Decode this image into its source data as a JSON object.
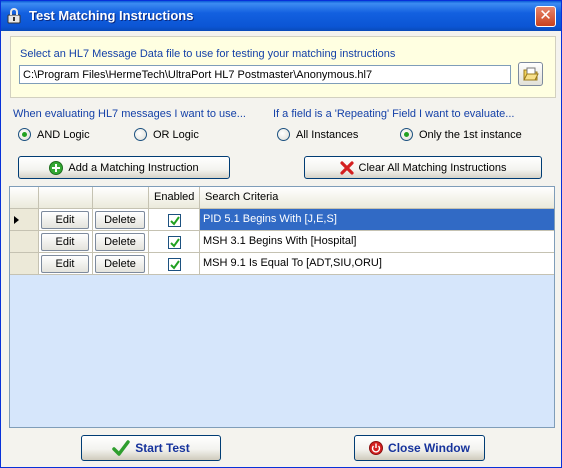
{
  "window": {
    "title": "Test Matching Instructions",
    "close_glyph": "✕"
  },
  "file_section": {
    "prompt": "Select an HL7 Message Data file to use for testing your matching instructions",
    "file_path": "C:\\Program Files\\HermeTech\\UltraPort HL7 Postmaster\\Anonymous.hl7",
    "browse_icon": "open-folder-icon"
  },
  "logic_section": {
    "label": "When evaluating HL7 messages I want to use...",
    "options": [
      {
        "label": "AND Logic",
        "checked": true
      },
      {
        "label": "OR Logic",
        "checked": false
      }
    ]
  },
  "repeat_section": {
    "label": "If a field is a 'Repeating' Field I want to evaluate...",
    "options": [
      {
        "label": "All Instances",
        "checked": false
      },
      {
        "label": "Only the 1st instance",
        "checked": true
      }
    ]
  },
  "actions": {
    "add_label": "Add a Matching Instruction",
    "clear_label": "Clear All Matching Instructions"
  },
  "grid": {
    "columns": {
      "enabled": "Enabled",
      "criteria": "Search Criteria"
    },
    "edit_label": "Edit",
    "delete_label": "Delete",
    "rows": [
      {
        "criteria": "PID 5.1 Begins With [J,E,S]",
        "enabled": true,
        "selected": true
      },
      {
        "criteria": "MSH 3.1 Begins With [Hospital]",
        "enabled": true,
        "selected": false
      },
      {
        "criteria": "MSH 9.1 Is Equal To [ADT,SIU,ORU]",
        "enabled": true,
        "selected": false
      }
    ]
  },
  "footer": {
    "start_label": "Start Test",
    "close_label": "Close Window"
  },
  "colors": {
    "title_bar": "#0b55d4",
    "label_blue": "#1541a8",
    "selection": "#316ac5",
    "grid_background": "#d6e6fb",
    "file_panel": "#ffffe1"
  }
}
